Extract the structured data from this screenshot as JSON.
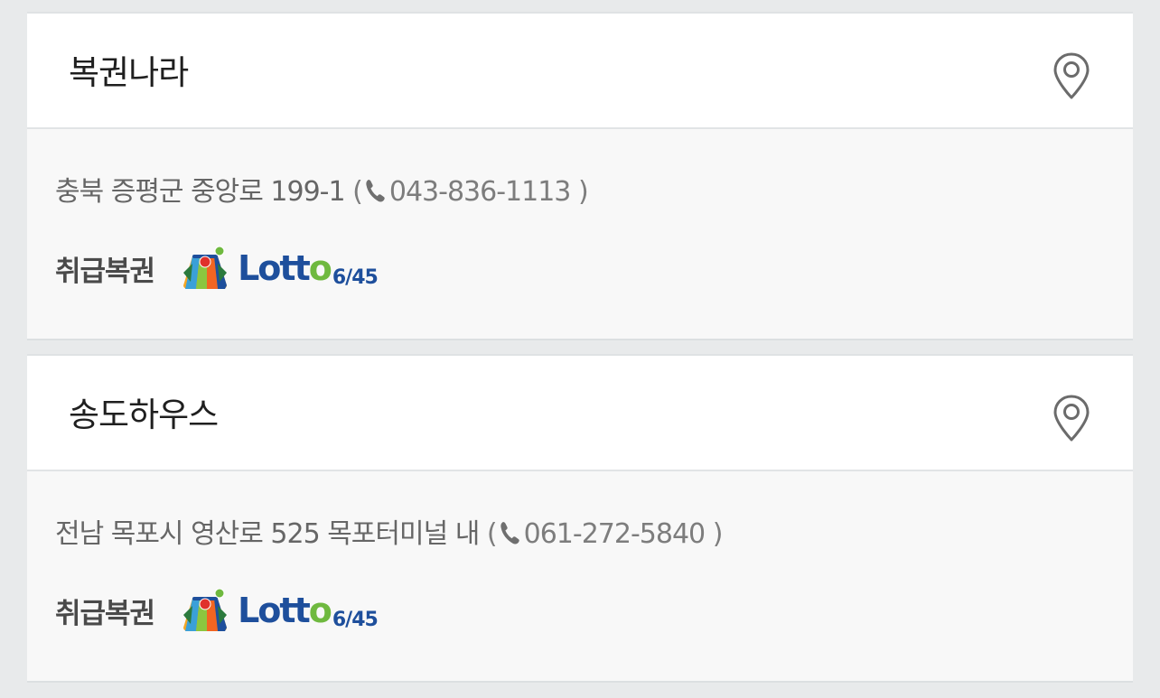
{
  "stores": [
    {
      "name": "복권나라",
      "address": "충북 증평군 중앙로 199-1",
      "phone_open": "(",
      "phone": "043-836-1113",
      "phone_close": ")",
      "types_label": "취급복권",
      "lottery": {
        "word_a": "Lott",
        "word_b": "o",
        "sub": "6/45"
      }
    },
    {
      "name": "송도하우스",
      "address": "전남 목포시 영산로 525 목포터미널 내",
      "phone_open": "(",
      "phone": "061-272-5840",
      "phone_close": ")",
      "types_label": "취급복권",
      "lottery": {
        "word_a": "Lott",
        "word_b": "o",
        "sub": "6/45"
      }
    }
  ],
  "icons": {
    "location": "location-pin-icon",
    "phone": "phone-icon"
  },
  "colors": {
    "background": "#e8eaeb",
    "header_bg": "#ffffff",
    "body_bg": "#f8f8f8",
    "lotto_blue": "#1e4f9c",
    "lotto_green": "#6fb93f"
  }
}
